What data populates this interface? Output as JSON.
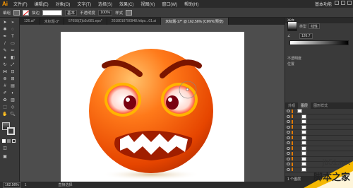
{
  "menu": {
    "logo": "Ai",
    "items": [
      "文件(F)",
      "编辑(E)",
      "对象(O)",
      "文字(T)",
      "选择(S)",
      "效果(C)",
      "视图(V)",
      "窗口(W)",
      "帮助(H)"
    ],
    "workspace": "基本功能"
  },
  "control": {
    "label": "编组",
    "stroke_label": "描边",
    "stroke_value": "基本",
    "opacity_label": "不透明度",
    "opacity_value": "100%",
    "style_label": "样式"
  },
  "tabs": [
    {
      "label": "126.ai*"
    },
    {
      "label": "未标题-3*"
    },
    {
      "label": "57658(2)b3c681.eps*"
    },
    {
      "label": "2018010790948.https...01.ai"
    },
    {
      "label": "未标题-17* @ 162.56% (CMYK/预览)",
      "active": true
    }
  ],
  "panel": {
    "title": "渐变",
    "type_label": "类型",
    "type_value": "线性",
    "angle_value": "126.7",
    "opacity_label": "不透明度",
    "position_label": "位置"
  },
  "layers": {
    "tabs": [
      "外观",
      "图层",
      "图形样式"
    ],
    "active": "图层",
    "row_count": 12,
    "footer": "1 个图层"
  },
  "status": {
    "zoom": "162.56%",
    "page": "1",
    "tool": "直接选择"
  },
  "watermark": {
    "site": "jb51.net",
    "name": "脚本之家"
  },
  "colors": {
    "face_orange": "#ff6a00",
    "face_dark": "#d23a00",
    "teeth": "#ffffff",
    "brow": "#7a1500"
  }
}
